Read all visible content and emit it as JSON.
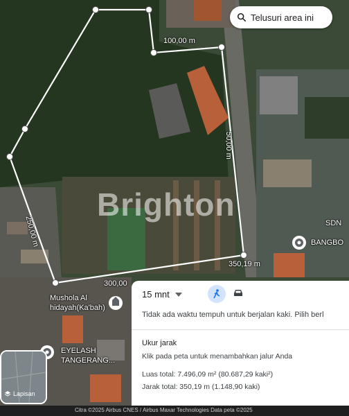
{
  "search": {
    "label": "Telusuri area ini",
    "icon": "search-icon"
  },
  "measurements": {
    "top": "100,00 m",
    "right": "50,00 m",
    "left": "250,00 m",
    "bottom_left": "300,00",
    "bottom_right": "350,19 m"
  },
  "places": {
    "sdn": "SDN",
    "bangbo": "BANGBO",
    "mushola_line1": "Mushola Al",
    "mushola_line2": "hidayah(Ka'bah)",
    "eyelash_line1": "EYELASH",
    "eyelash_line2": "TANGERANG..."
  },
  "watermark": "Brighton",
  "directions": {
    "time": "15 mnt",
    "walk_notice": "Tidak ada waktu tempuh untuk berjalan kaki. Pilih berl",
    "walk_icon": "walk-icon",
    "car_icon": "car-icon"
  },
  "measure_panel": {
    "title": "Ukur jarak",
    "hint": "Klik pada peta untuk menambahkan jalur Anda",
    "area": "Luas total: 7.496,09 m² (80.687,29 kaki²)",
    "distance": "Jarak total: 350,19 m (1.148,90 kaki)"
  },
  "layers": {
    "label": "Lapisan",
    "icon": "layers-icon"
  },
  "attribution": "Citra ©2025 Airbus CNES / Airbus Maxar Technologies Data peta ©2025",
  "colors": {
    "measure_line": "#ffffff",
    "panel_bg": "#ffffff",
    "accent_blue": "#1a73e8"
  }
}
